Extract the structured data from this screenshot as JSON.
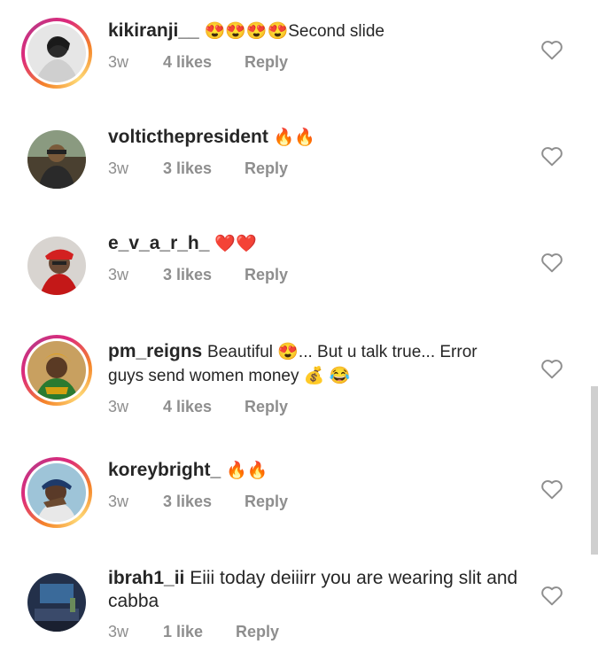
{
  "comments": [
    {
      "username": "kikiranji__",
      "text": "😍😍😍😍Second  slide",
      "time": "3w",
      "likes": "4 likes",
      "reply": "Reply",
      "story_ring": true
    },
    {
      "username": "volticthepresident",
      "text": "🔥🔥",
      "time": "3w",
      "likes": "3 likes",
      "reply": "Reply",
      "story_ring": false
    },
    {
      "username": "e_v_a_r_h_",
      "text": "❤️❤️",
      "time": "3w",
      "likes": "3 likes",
      "reply": "Reply",
      "story_ring": false
    },
    {
      "username": "pm_reigns",
      "text": "Beautiful 😍... But u talk true... Error guys send women money 💰 😂",
      "time": "3w",
      "likes": "4 likes",
      "reply": "Reply",
      "story_ring": true
    },
    {
      "username": "koreybright_",
      "text": "🔥🔥",
      "time": "3w",
      "likes": "3 likes",
      "reply": "Reply",
      "story_ring": true
    },
    {
      "username": "ibrah1_ii",
      "text": "Eiii today deiiirr you are wearing slit and cabba",
      "time": "3w",
      "likes": "1 like",
      "reply": "Reply",
      "story_ring": false
    }
  ],
  "icons": {
    "like": "heart-outline-icon"
  }
}
